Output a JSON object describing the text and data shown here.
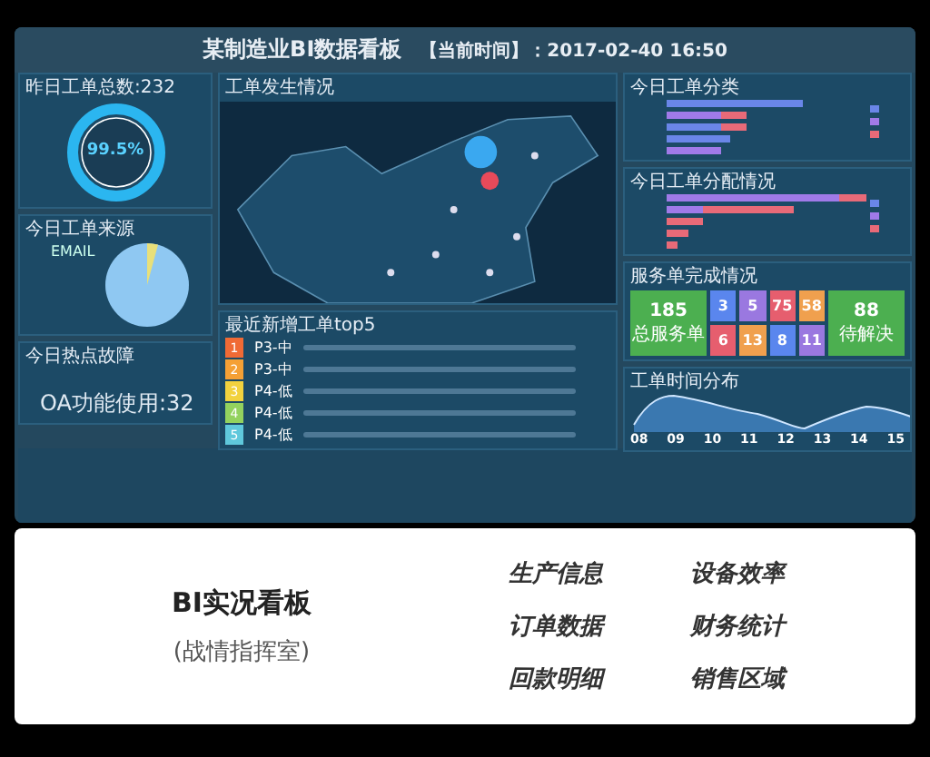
{
  "header": {
    "title": "某制造业BI数据看板",
    "time": "【当前时间】：2017-02-40 16:50"
  },
  "yesterday": {
    "title": "昨日工单总数:232",
    "percent": "99.5%"
  },
  "sources": {
    "title": "今日工单来源",
    "label": "EMAIL"
  },
  "hot": {
    "title": "今日热点故障",
    "headline": "OA功能使用:32"
  },
  "map": {
    "title": "工单发生情况"
  },
  "top5": {
    "title": "最近新增工单top5",
    "rows": [
      {
        "badge": "1",
        "priority": "P3-中",
        "color": "#f06a35"
      },
      {
        "badge": "2",
        "priority": "P3-中",
        "color": "#f5a035"
      },
      {
        "badge": "3",
        "priority": "P4-低",
        "color": "#f2d23e"
      },
      {
        "badge": "4",
        "priority": "P4-低",
        "color": "#93d25e"
      },
      {
        "badge": "5",
        "priority": "P4-低",
        "color": "#5fc8dc"
      }
    ]
  },
  "category": {
    "title": "今日工单分类"
  },
  "assign": {
    "title": "今日工单分配情况"
  },
  "service": {
    "title": "服务单完成情况",
    "total": {
      "value": "185",
      "label": "总服务单"
    },
    "tiles": [
      {
        "kind": "small",
        "value": "3",
        "color": "#5a86ee"
      },
      {
        "kind": "small",
        "value": "5",
        "color": "#9a78e0"
      },
      {
        "kind": "small",
        "value": "75",
        "color": "#e65e6e"
      },
      {
        "kind": "small",
        "value": "58",
        "color": "#f0a04e"
      },
      {
        "kind": "small",
        "value": "6",
        "color": "#e65e6e"
      },
      {
        "kind": "small",
        "value": "13",
        "color": "#f0a04e"
      },
      {
        "kind": "small",
        "value": "8",
        "color": "#5a86ee"
      },
      {
        "kind": "small",
        "value": "11",
        "color": "#9a78e0"
      }
    ],
    "pending": {
      "value": "88",
      "label": "待解决"
    }
  },
  "timeline": {
    "title": "工单时间分布",
    "x_labels": [
      "08",
      "09",
      "10",
      "11",
      "12",
      "13",
      "14",
      "15"
    ]
  },
  "caption": {
    "title": "BI实况看板",
    "subtitle": "(战情指挥室)",
    "items": [
      "生产信息",
      "设备效率",
      "订单数据",
      "财务统计",
      "回款明细",
      "销售区域"
    ]
  }
}
